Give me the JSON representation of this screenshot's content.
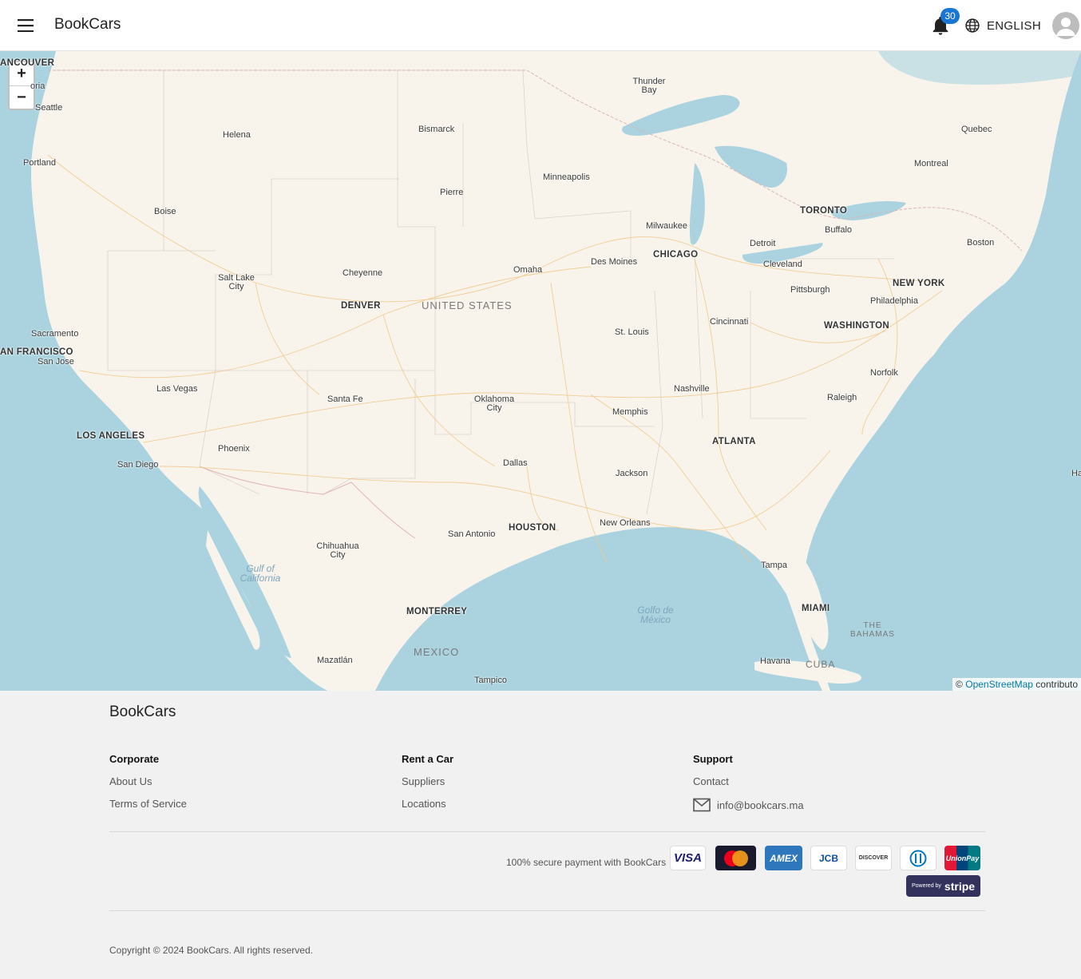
{
  "header": {
    "brand": "BookCars",
    "notification_count": "30",
    "language": "ENGLISH"
  },
  "map": {
    "zoom_in": "+",
    "zoom_out": "−",
    "attribution_prefix": "©",
    "attribution_link": "OpenStreetMap",
    "attribution_suffix": "contributo",
    "cities": [
      "ANCOUVER",
      "oria",
      "Seattle",
      "Portland",
      "Helena",
      "Boise",
      "Bismarck",
      "Pierre",
      "Minneapolis",
      "Thunder Bay",
      "Quebec",
      "Montreal",
      "TORONTO",
      "Buffalo",
      "Boston",
      "Milwaukee",
      "Detroit",
      "CHICAGO",
      "Des Moines",
      "Omaha",
      "Cheyenne",
      "Salt Lake City",
      "DENVER",
      "Cleveland",
      "NEW YORK",
      "Pittsburgh",
      "Philadelphia",
      "WASHINGTON",
      "Cincinnati",
      "St. Louis",
      "Sacramento",
      "AN FRANCISCO",
      "San Jose",
      "Las Vegas",
      "Santa Fe",
      "Oklahoma City",
      "Norfolk",
      "Nashville",
      "Raleigh",
      "Memphis",
      "ATLANTA",
      "LOS ANGELES",
      "Phoenix",
      "San Diego",
      "Dallas",
      "Jackson",
      "Ha",
      "HOUSTON",
      "New Orleans",
      "San Antonio",
      "Chihuahua City",
      "Tampa",
      "MONTERREY",
      "MIAMI",
      "Mazatlán",
      "Havana",
      "Tampico"
    ],
    "countries": [
      "UNITED STATES",
      "MEXICO",
      "CUBA",
      "THE BAHAMAS"
    ],
    "seas": [
      "Gulf of California",
      "Golfo de México"
    ]
  },
  "footer": {
    "brand": "BookCars",
    "corporate": {
      "title": "Corporate",
      "links": [
        "About Us",
        "Terms of Service"
      ]
    },
    "rent": {
      "title": "Rent a Car",
      "links": [
        "Suppliers",
        "Locations"
      ]
    },
    "support": {
      "title": "Support",
      "contact": "Contact",
      "email": "info@bookcars.ma"
    },
    "secure_text": "100% secure payment with BookCars",
    "payment_cards": [
      "VISA",
      "mastercard",
      "AMEX",
      "JCB",
      "DISCOVER",
      "diners",
      "UnionPay"
    ],
    "stripe_prefix": "Powered by",
    "stripe_brand": "stripe",
    "copyright": "Copyright © 2024 BookCars. All rights reserved."
  },
  "colors": {
    "accent": "#1976d2",
    "land": "#f8f4ec",
    "water": "#aad3df",
    "footer_bg": "#f1f1f1"
  }
}
